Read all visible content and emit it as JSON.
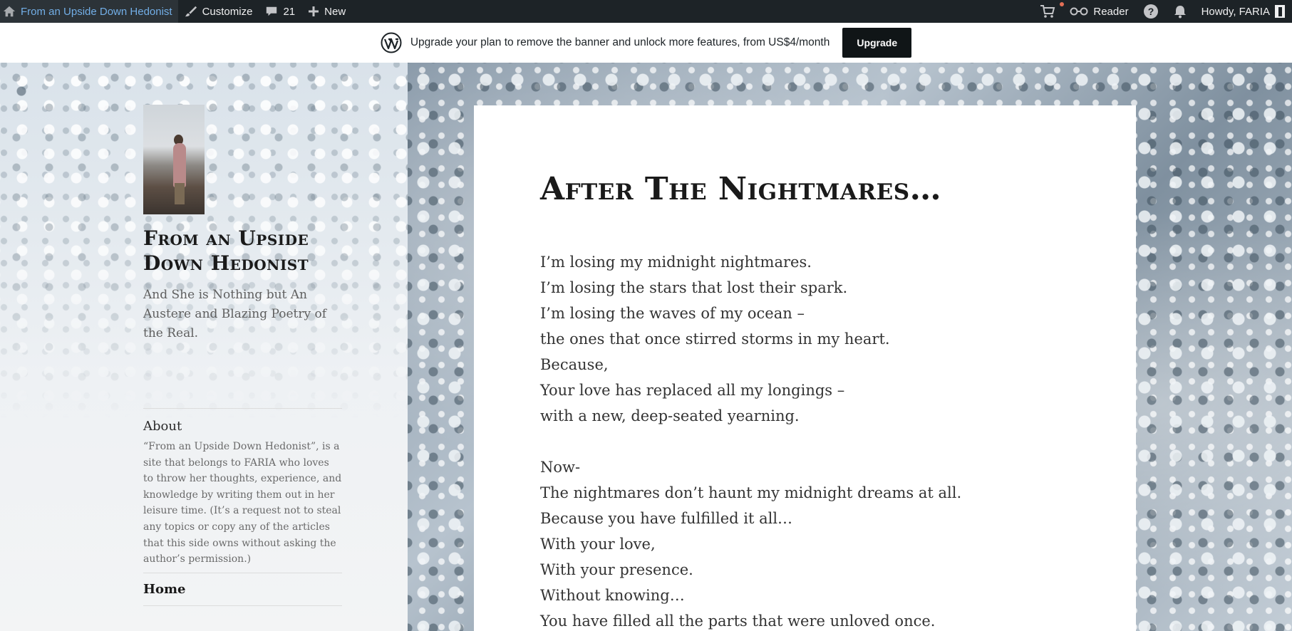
{
  "admin_bar": {
    "site_name": "From an Upside Down Hedonist",
    "customize": "Customize",
    "comments_count": "21",
    "new_label": "New",
    "reader_label": "Reader",
    "howdy": "Howdy, FARIA"
  },
  "banner": {
    "text": "Upgrade your plan to remove the banner and unlock more features, from US$4/month",
    "button": "Upgrade"
  },
  "sidebar": {
    "site_title": "From an Upside Down Hedonist",
    "description": "And She is Nothing but An Austere and Blazing Poetry of the Real.",
    "about_title": "About",
    "about_text": "“From an Upside Down Hedonist”, is a site that belongs to FARIA who loves to throw her thoughts, experience, and knowledge by writing them out in her leisure time. (It’s a request not to steal any topics or copy any of the articles that this side owns without asking the author’s permission.)",
    "menu_home": "Home"
  },
  "post": {
    "title": "After The Nightmares…",
    "lines": [
      "I’m losing my midnight nightmares.",
      "I’m losing the stars that lost their spark.",
      "I’m losing the waves of my ocean –",
      "the ones that once stirred storms in my heart.",
      "Because,",
      "Your love has replaced all my longings –",
      "with a new, deep-seated yearning.",
      "",
      "Now-",
      "The nightmares don’t haunt my midnight dreams at all.",
      "Because you have fulfilled it all…",
      "With your love,",
      "With your presence.",
      "Without knowing…",
      "You have filled all the parts that were unloved once."
    ]
  },
  "icons": {
    "home": "home-icon",
    "brush": "brush-icon",
    "comment": "comment-bubble-icon",
    "plus": "plus-icon",
    "cart": "cart-icon",
    "reader": "reader-glasses-icon",
    "help": "help-icon",
    "bell": "bell-icon",
    "wordpress": "wordpress-logo-icon"
  },
  "colors": {
    "admin_bar_bg": "#1d2327",
    "site_link": "#72aee6",
    "upgrade_btn": "#101517",
    "cart_badge": "#e26f56"
  }
}
